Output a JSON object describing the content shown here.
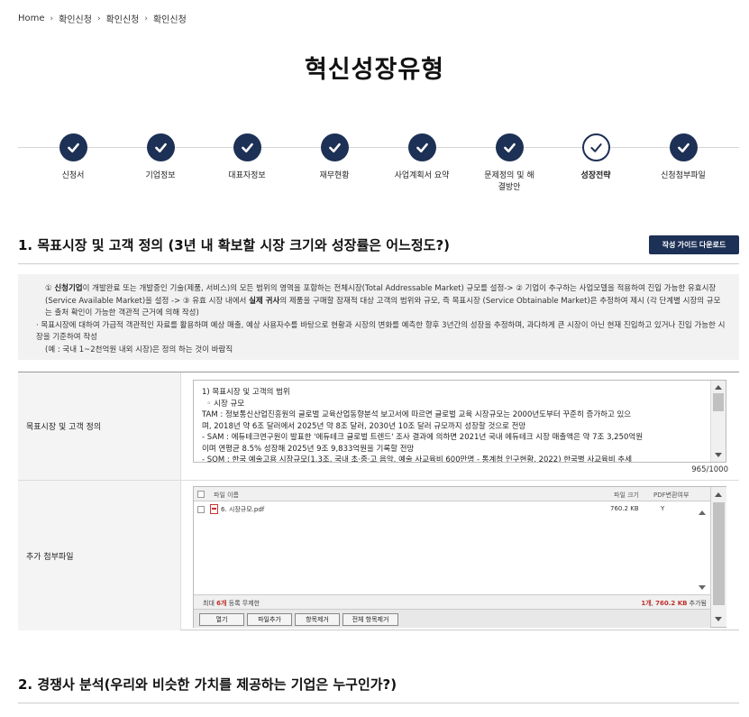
{
  "breadcrumb": [
    "Home",
    "확인신청",
    "확인신청",
    "확인신청"
  ],
  "page_title": "혁신성장유형",
  "steps": [
    {
      "label": "신청서",
      "state": "done"
    },
    {
      "label": "기업정보",
      "state": "done"
    },
    {
      "label": "대표자정보",
      "state": "done"
    },
    {
      "label": "재무현황",
      "state": "done"
    },
    {
      "label": "사업계획서 요약",
      "state": "done"
    },
    {
      "label": "문제정의 및 해결방안",
      "state": "done"
    },
    {
      "label": "성장전략",
      "state": "current"
    },
    {
      "label": "신청첨부파일",
      "state": "done"
    }
  ],
  "section1": {
    "title": "1. 목표시장 및 고객 정의 (3년 내 확보할 시장 크기와 성장률은 어느정도?)",
    "guide_button": "작성 가이드 다운로드",
    "notice": {
      "line1a": "① ",
      "line1b": "신청기업",
      "line1c": "이 개발완료 또는 개발중인 기술(제품, 서비스)의 모든 범위의 영역을 포함하는 전체시장(Total Addressable Market) 규모를 설정-> ② 기업이 추구하는 사업모델을 적용하여 진입 가능한 유효시장 (Service Available Market)을 설정 -> ③ 유효 시장 내에서 ",
      "line1d": "실제 귀사",
      "line1e": "의 제품을 구매할 잠재적 대상 고객의 범위와 규모, 즉 목표시장 (Service Obtainable Market)은 추정하여 제시 (각 단계별 시장의 규모는 출처 확인이 가능한 객관적 근거에 의해 작성)",
      "line2": "목표시장에 대하여 가급적 객관적인 자료를 활용하며 예상 매출, 예상 사용자수를 바탕으로 현황과 시장의 변화를 예측한 향후 3년간의 성장을 추정하며, 과다하게 큰 시장이 아닌 현재 진입하고 있거나 진입 가능한 시장을 기준하여 작성",
      "line3": "(예 : 국내 1~2천억원 내외 시장)은 정의 하는 것이 바람직"
    },
    "row1_label": "목표시장 및 고객 정의",
    "textarea_lines": [
      "1) 목표시장 및 고객의 범위",
      "  ◦ 시장 규모",
      "TAM : 정보통신산업진흥원의 글로벌 교육산업동향분석 보고서에 따르면 글로벌 교육 시장규모는 2000년도부터 꾸준히 증가하고 있으",
      "며, 2018년 약 6조 달러에서 2025년 약 8조 달러, 2030년 10조 달러 규모까지 성장할 것으로 전망",
      "- SAM : 에듀테크연구원이 발표한 '에듀테크 글로벌 트렌드' 조사 결과에 의하면 2021년 국내 에듀테크 시장 매출액은 약 7조 3,250억원",
      "이며 연평균 8.5% 성장해 2025년 9조 9,833억원을 기록할 전망",
      "- SOM : 한국 예술고용 시장규모(1.3조, 국내 초·중·고 음악, 예술 사교육비 600만명 - 통계청 인구현황, 2022) 한국별 사교육비 추세"
    ],
    "char_count": "965/1000",
    "row2_label": "추가 첨부파일",
    "uploader": {
      "col_name": "파일 이름",
      "col_size": "파일 크기",
      "col_pdf": "PDF변환여부",
      "files": [
        {
          "name": "6. 시장규모.pdf",
          "size": "760.2 KB",
          "pdf": "Y"
        }
      ],
      "limit_prefix": "최대 ",
      "limit_count": "6개",
      "limit_suffix": " 등록 무제한",
      "total_count": "1개",
      "total_size": "760.2 KB",
      "total_suffix": " 추가됨",
      "buttons": [
        "열기",
        "파일추가",
        "항목제거",
        "전체 항목제거"
      ]
    }
  },
  "section2": {
    "title": "2. 경쟁사 분석(우리와 비슷한 가치를 제공하는 기업은 누구인가?)"
  },
  "colors": {
    "primary": "#1d3055",
    "accent_red": "#c0302b"
  }
}
